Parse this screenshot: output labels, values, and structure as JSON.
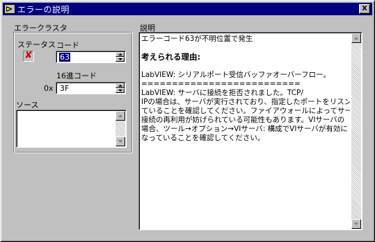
{
  "window": {
    "title": "エラーの説明",
    "close_label": "X"
  },
  "error_cluster": {
    "label": "エラークラスタ",
    "status_label": "ステータス",
    "status_icon": "x-mark-icon",
    "code_label": "コード",
    "code_value": "63",
    "hex_label": "16進コード",
    "hex_prefix": "0x",
    "hex_value": "3F",
    "source_label": "ソース",
    "source_value": ""
  },
  "explanation": {
    "label": "説明",
    "lines": [
      "エラーコード63が不明位置で発生",
      "",
      "考えられる理由:",
      "",
      "LabVIEW:  シリアルポート受信バッファオーバーフロー。",
      "==========================",
      "LabVIEW:  サーバに接続を拒否されました。TCP/",
      "IPの場合は、サーバが実行されており、指定したポートをリスンし",
      "ていることを確認してください。ファイアウォールによってサーバによる",
      "接続の再利用が妨げられている可能性もあります。VIサーバの",
      "場合、ツール→オプション→VIサーバ: 構成でVIサーバが有効に",
      "なっていることを確認してください。"
    ]
  },
  "colors": {
    "titlebar": "#000080",
    "face": "#c0c0c0",
    "selection": "#000080",
    "error_mark": "#cc0000"
  }
}
